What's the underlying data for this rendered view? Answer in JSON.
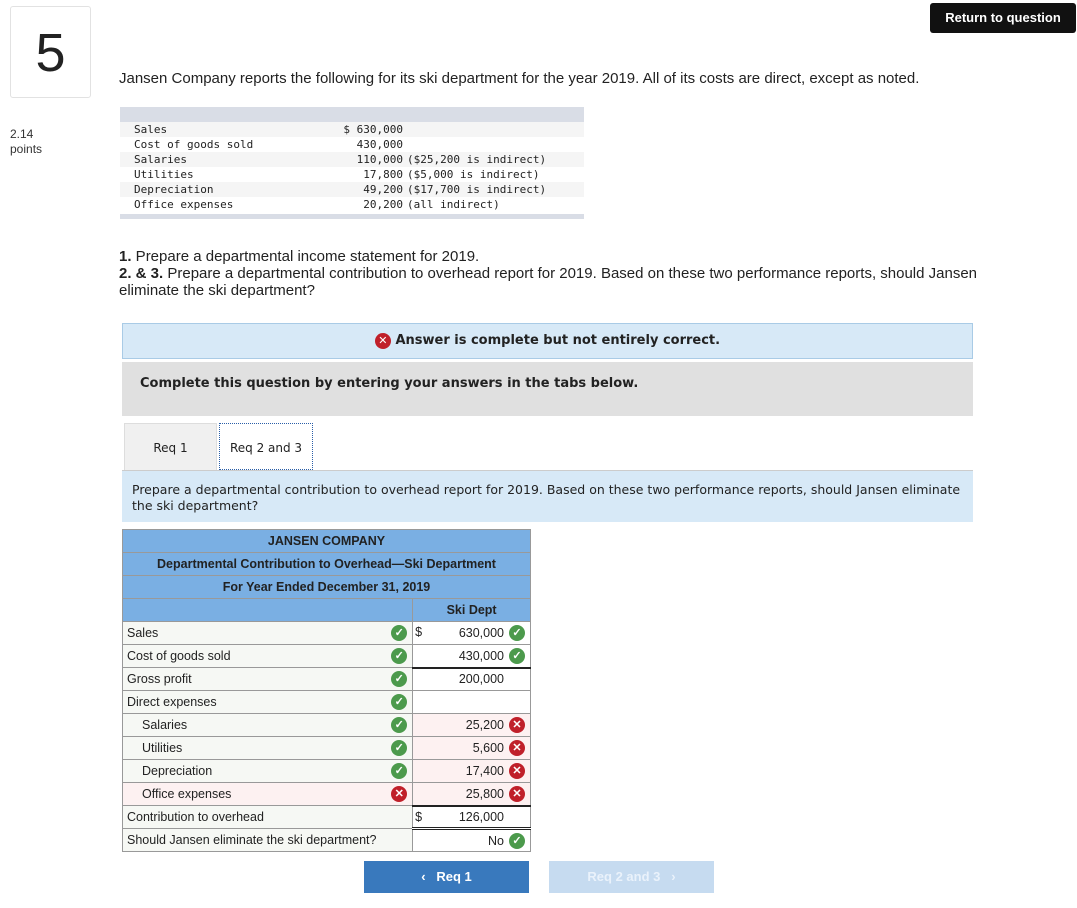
{
  "question_number": "5",
  "return_button": "Return to question",
  "points": {
    "value": "2.14",
    "label": "points"
  },
  "intro": "Jansen Company reports the following for its ski department for the year 2019. All of its costs are direct, except as noted.",
  "given": [
    {
      "label": "Sales",
      "value": "$ 630,000",
      "note": ""
    },
    {
      "label": "Cost of goods sold",
      "value": "430,000",
      "note": ""
    },
    {
      "label": "Salaries",
      "value": "110,000",
      "note": "($25,200 is indirect)"
    },
    {
      "label": "Utilities",
      "value": "17,800",
      "note": "($5,000 is indirect)"
    },
    {
      "label": "Depreciation",
      "value": "49,200",
      "note": "($17,700 is indirect)"
    },
    {
      "label": "Office expenses",
      "value": "20,200",
      "note": "(all indirect)"
    }
  ],
  "questions": [
    {
      "num": "1.",
      "text": " Prepare a departmental income statement for 2019."
    },
    {
      "num": "2. & 3.",
      "text": " Prepare a departmental contribution to overhead report for 2019. Based on these two performance reports, should Jansen eliminate the ski department?"
    }
  ],
  "banner": "Answer is complete but not entirely correct.",
  "instruction_box": "Complete this question by entering your answers in the tabs below.",
  "tabs": [
    {
      "label": "Req 1"
    },
    {
      "label": "Req 2 and 3",
      "active": true
    }
  ],
  "tab_instruction": "Prepare a departmental contribution to overhead report for 2019. Based on these two performance reports, should Jansen eliminate the ski department?",
  "report": {
    "company": "JANSEN COMPANY",
    "title": "Departmental Contribution to Overhead—Ski Department",
    "period": "For Year Ended December 31, 2019",
    "column": "Ski Dept",
    "rows": [
      {
        "label": "Sales",
        "label_status": "correct",
        "dollar": "$",
        "value": "630,000",
        "value_status": "correct"
      },
      {
        "label": "Cost of goods sold",
        "label_status": "correct",
        "dollar": "",
        "value": "430,000",
        "value_status": "correct"
      },
      {
        "label": "Gross profit",
        "label_status": "correct",
        "dollar": "",
        "value": "200,000",
        "value_status": ""
      },
      {
        "label": "Direct expenses",
        "label_status": "correct",
        "dollar": "",
        "value": "",
        "value_status": ""
      },
      {
        "label": "Salaries",
        "label_status": "correct",
        "dollar": "",
        "value": "25,200",
        "value_status": "incorrect"
      },
      {
        "label": "Utilities",
        "label_status": "correct",
        "dollar": "",
        "value": "5,600",
        "value_status": "incorrect"
      },
      {
        "label": "Depreciation",
        "label_status": "correct",
        "dollar": "",
        "value": "17,400",
        "value_status": "incorrect"
      },
      {
        "label": "Office expenses",
        "label_status": "incorrect",
        "dollar": "",
        "value": "25,800",
        "value_status": "incorrect"
      },
      {
        "label": "Contribution to overhead",
        "label_status": "",
        "dollar": "$",
        "value": "126,000",
        "value_status": ""
      },
      {
        "label": "Should Jansen eliminate the ski department?",
        "label_status": "",
        "dollar": "",
        "value": "No",
        "value_status": "correct"
      }
    ]
  },
  "nav": {
    "prev": "Req 1",
    "next": "Req 2 and 3"
  }
}
